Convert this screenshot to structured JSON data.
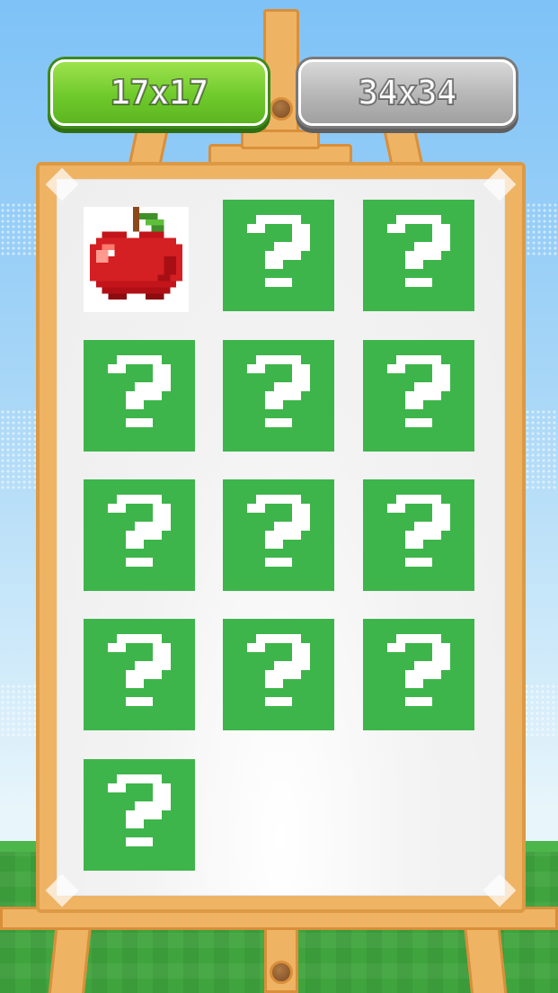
{
  "size_options": [
    {
      "label": "17x17",
      "selected": true
    },
    {
      "label": "34x34",
      "selected": false
    }
  ],
  "levels": [
    {
      "state": "completed",
      "image": "apple-icon"
    },
    {
      "state": "locked",
      "icon": "question-mark-icon"
    },
    {
      "state": "locked",
      "icon": "question-mark-icon"
    },
    {
      "state": "locked",
      "icon": "question-mark-icon"
    },
    {
      "state": "locked",
      "icon": "question-mark-icon"
    },
    {
      "state": "locked",
      "icon": "question-mark-icon"
    },
    {
      "state": "locked",
      "icon": "question-mark-icon"
    },
    {
      "state": "locked",
      "icon": "question-mark-icon"
    },
    {
      "state": "locked",
      "icon": "question-mark-icon"
    },
    {
      "state": "locked",
      "icon": "question-mark-icon"
    },
    {
      "state": "locked",
      "icon": "question-mark-icon"
    },
    {
      "state": "locked",
      "icon": "question-mark-icon"
    },
    {
      "state": "locked",
      "icon": "question-mark-icon"
    }
  ],
  "colors": {
    "tile_locked": "#3db54a",
    "button_selected": "#6fca2c",
    "button_unselected": "#b6b6b6",
    "sky": "#7ec2f7",
    "grass": "#3fa43d",
    "easel_wood": "#efb364"
  }
}
